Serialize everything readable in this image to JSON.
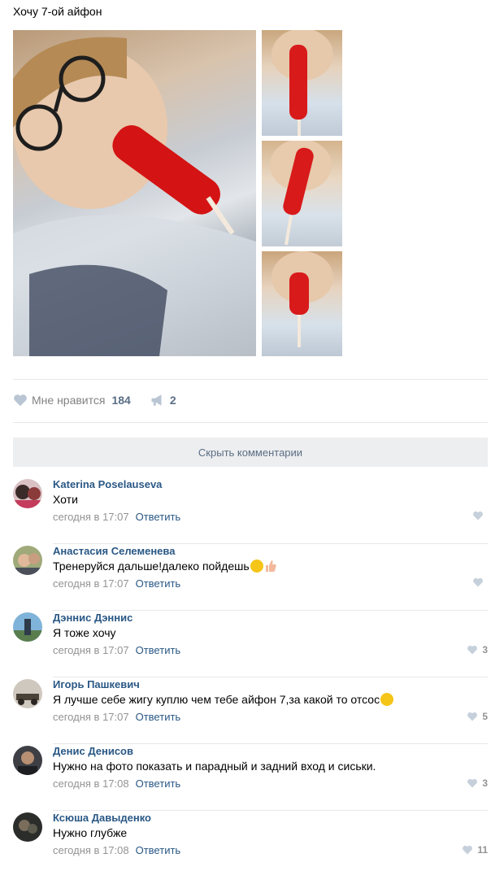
{
  "post": {
    "title": "Хочу 7-ой айфон"
  },
  "actions": {
    "like_label": "Мне нравится",
    "like_count": "184",
    "share_count": "2"
  },
  "hide_comments_label": "Скрыть комментарии",
  "comments": [
    {
      "author": "Katerina Poselauseva",
      "text": "Хоти",
      "time": "сегодня в 17:07",
      "reply": "Ответить",
      "likes": ""
    },
    {
      "author": "Анастасия Селеменева",
      "text": "Тренеруйся дальше!далеко пойдешь",
      "time": "сегодня в 17:07",
      "reply": "Ответить",
      "likes": ""
    },
    {
      "author": "Дэннис Дэннис",
      "text": "Я тоже хочу",
      "time": "сегодня в 17:07",
      "reply": "Ответить",
      "likes": "3"
    },
    {
      "author": "Игорь Пашкевич",
      "text": "Я лучше себе жигу куплю чем тебе айфон 7,за какой то отсос",
      "time": "сегодня в 17:07",
      "reply": "Ответить",
      "likes": "5"
    },
    {
      "author": "Денис Денисов",
      "text": "Нужно на фото показать и парадный и задний вход и сиськи.",
      "time": "сегодня в 17:08",
      "reply": "Ответить",
      "likes": "3"
    },
    {
      "author": "Ксюша Давыденко",
      "text": "Нужно глубже",
      "time": "сегодня в 17:08",
      "reply": "Ответить",
      "likes": "11"
    }
  ],
  "colors": {
    "link": "#2a5885",
    "meta": "#939393",
    "divider": "#e7e8ec",
    "button_bg": "#edeef0"
  }
}
